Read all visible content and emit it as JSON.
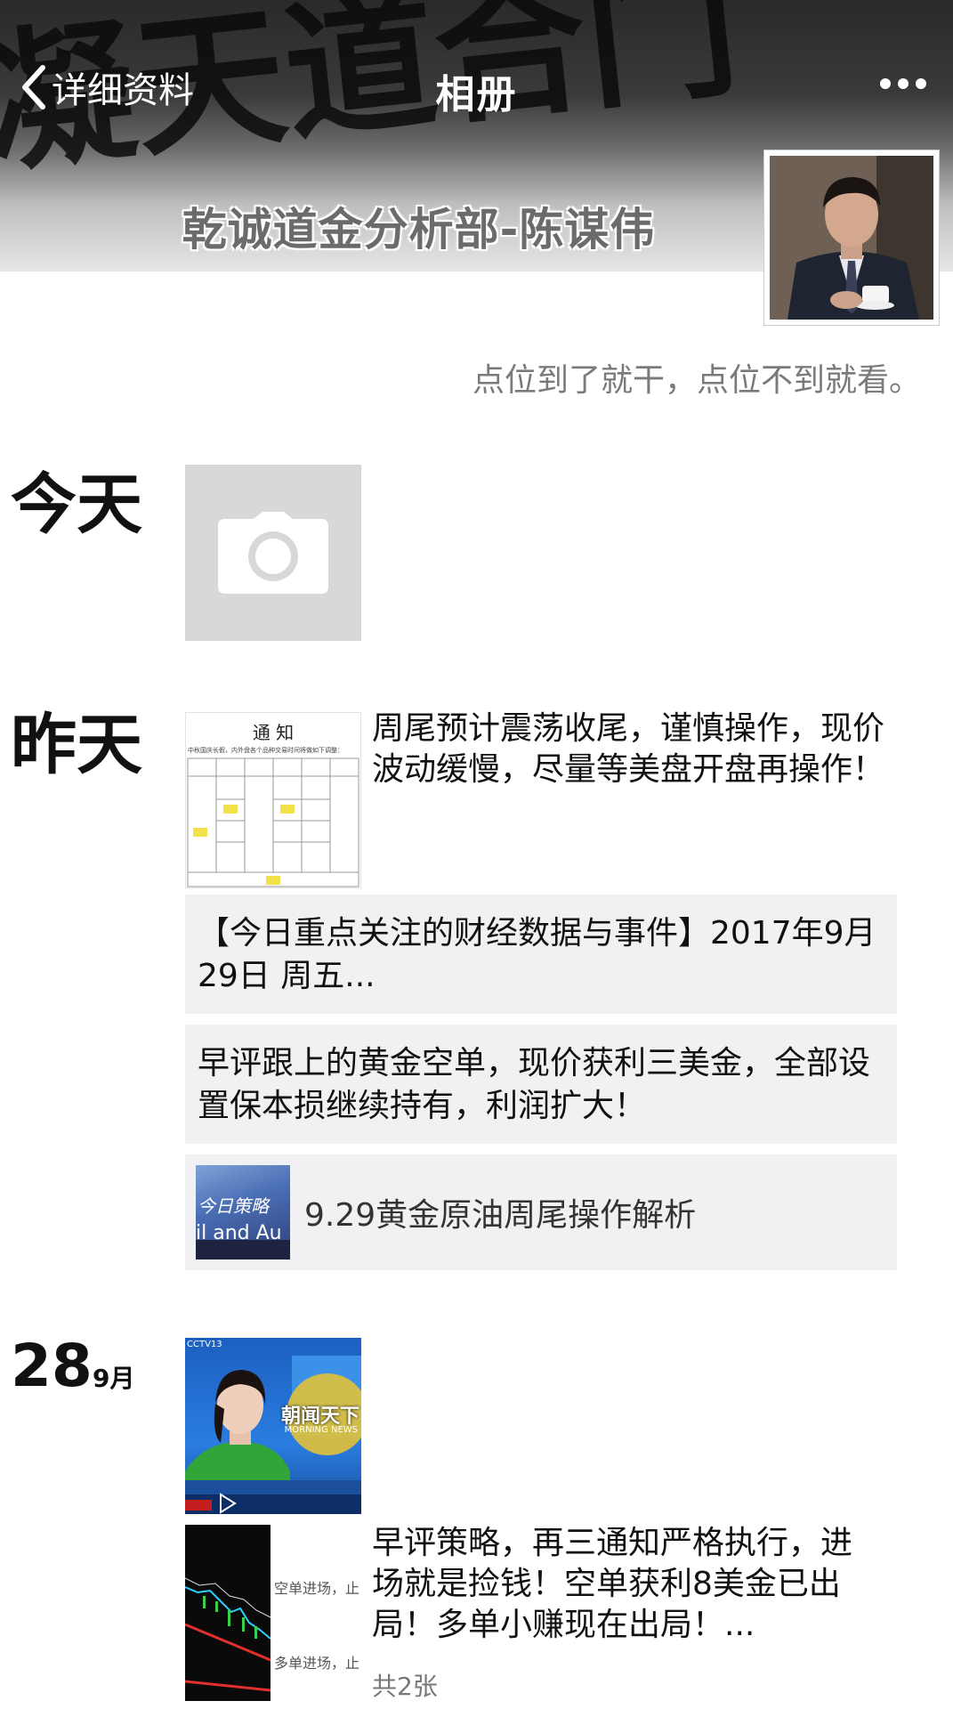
{
  "nav": {
    "back_label": "详细资料",
    "title": "相册",
    "more_icon": "more-horizontal-icon"
  },
  "cover": {
    "caption": "乾诚道金分析部-陈谋伟",
    "bg_text": "凝天道合门"
  },
  "profile": {
    "signature": "点位到了就干，点位不到就看。"
  },
  "timeline": {
    "today": {
      "label": "今天",
      "upload_icon": "camera-icon"
    },
    "yesterday": {
      "label": "昨天",
      "notice_thumb_title": "通  知",
      "notice_thumb_subtitle": "中秋国庆长假，内外盘各个品种交易时间将做如下调整：",
      "post_text": "周尾预计震荡收尾，谨慎操作，现价波动缓慢，尽量等美盘开盘再操作！",
      "shared_article": "【今日重点关注的财经数据与事件】2017年9月29日 周五...",
      "status_text": "早评跟上的黄金空单，现价获利三美金，全部设置保本损继续持有，利润扩大！",
      "link_thumb_line1": "今日策略",
      "link_thumb_line2": "il and Au",
      "link_title": "9.29黄金原油周尾操作解析"
    },
    "sep28": {
      "day": "28",
      "month": "9月",
      "news_thumb_badge": "朝闻天下",
      "news_thumb_sub": "MORNING NEWS",
      "news_thumb_channel": "CCTV13",
      "chart_thumb_label1": "空单进场，止",
      "chart_thumb_label2": "多单进场，止",
      "post_text": "早评策略，再三通知严格执行，进场就是捡钱！空单获利8美金已出局！多单小赚现在出局！...",
      "photo_count": "共2张"
    }
  },
  "colors": {
    "cover_dark": "#2a2a2a",
    "tile_gray": "#d8d8d8",
    "share_bg": "#f1f1f3",
    "muted_text": "#7a7a7a"
  }
}
